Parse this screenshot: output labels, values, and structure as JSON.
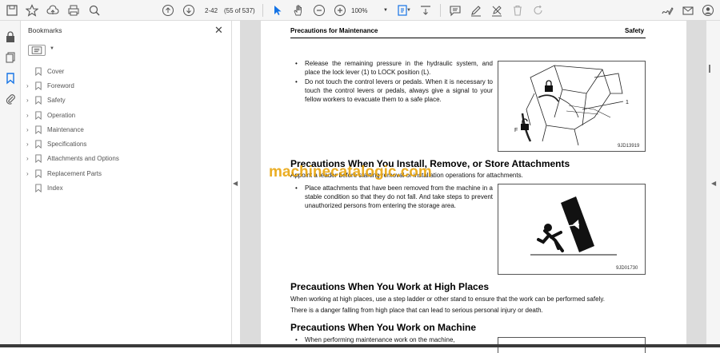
{
  "toolbar": {
    "page_current": "2-42",
    "page_count": "(55 of 537)",
    "zoom": "100%"
  },
  "bookmarks": {
    "title": "Bookmarks",
    "items": [
      {
        "label": "Cover",
        "expandable": false
      },
      {
        "label": "Foreword",
        "expandable": true
      },
      {
        "label": "Safety",
        "expandable": true
      },
      {
        "label": "Operation",
        "expandable": true
      },
      {
        "label": "Maintenance",
        "expandable": true
      },
      {
        "label": "Specifications",
        "expandable": true
      },
      {
        "label": "Attachments and Options",
        "expandable": true
      },
      {
        "label": "Replacement Parts",
        "expandable": true
      },
      {
        "label": "Index",
        "expandable": false
      }
    ]
  },
  "document": {
    "header_left": "Precautions for Maintenance",
    "header_right": "Safety",
    "section1_bullets": [
      "Release the remaining pressure in the hydraulic system, and place the lock lever (1) to LOCK position (L).",
      "Do not touch the control levers or pedals. When it is necessary to touch the control levers or pedals, always give a signal to your fellow workers to evacuate them to a safe place."
    ],
    "figure1": {
      "code": "9JD13919",
      "label_1": "1",
      "label_f": "F"
    },
    "section2_title": "Precautions When You Install, Remove, or Store Attachments",
    "section2_intro": "Appoint a leader before starting removal or installation operations for attachments.",
    "section2_bullets": [
      "Place attachments that have been removed from the machine in a stable condition so that they do not fall. And take steps to prevent unauthorized persons from entering the storage area."
    ],
    "figure2": {
      "code": "9JD01730"
    },
    "section3_title": "Precautions When You Work at High Places",
    "section3_para1": "When working at high places, use a step ladder or other stand to ensure that the work can be performed safely.",
    "section3_para2": "There is a danger falling from high place that can lead to serious personal injury or death.",
    "section4_title": "Precautions When You Work on Machine",
    "section4_bullets": [
      "When performing maintenance work on the machine,"
    ]
  },
  "watermark": "machinecatalogic.com"
}
